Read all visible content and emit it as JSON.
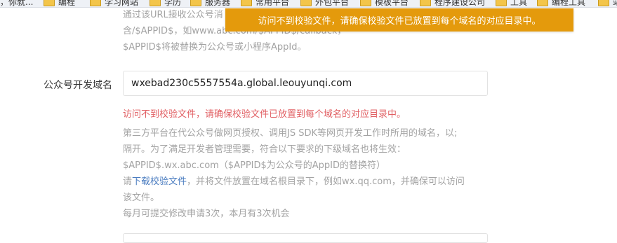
{
  "bookmarks": [
    {
      "label": "，你就..."
    },
    {
      "label": "编程"
    },
    {
      "label": "学习网站"
    },
    {
      "label": "学历"
    },
    {
      "label": "服务器"
    },
    {
      "label": "常用平台"
    },
    {
      "label": "外包平台"
    },
    {
      "label": "模板平台"
    },
    {
      "label": "程序建设公司"
    },
    {
      "label": "工具"
    },
    {
      "label": "编程工具"
    },
    {
      "label": "站"
    }
  ],
  "url_hint": {
    "line1": "通过该URL接收公众号消",
    "line2": "含/$APPID$，如www.abc.com/$APPID$/callback，",
    "line3": "$APPID$将被替换为公众号或小程序AppId。"
  },
  "toast": {
    "message": "访问不到校验文件，请确保校验文件已放置到每个域名的对应目录中。",
    "color": "#e49a0c"
  },
  "domain_field": {
    "label": "公众号开发域名",
    "value": "wxebad230c5557554a.global.leouyunqi.com"
  },
  "error_message": "访问不到校验文件，请确保校验文件已放置到每个域名的对应目录中。",
  "description": {
    "line1": "第三方平台在代公众号做网页授权、调用JS SDK等网页开发工作时所用的域名，以;",
    "line2": "隔开。为了满足开发者管理需要，符合以下要求的下级域名也将生效：",
    "line3": "$APPID$.wx.abc.com（$APPID$为公众号的AppID的替换符）",
    "line4_prefix": "请",
    "download_link": "下载校验文件",
    "line4_suffix": "，并将文件放置在域名根目录下，例如wx.qq.com，并确保可以访问",
    "line5": "该文件。",
    "line6": "每月可提交修改申请3次，本月有3次机会"
  }
}
